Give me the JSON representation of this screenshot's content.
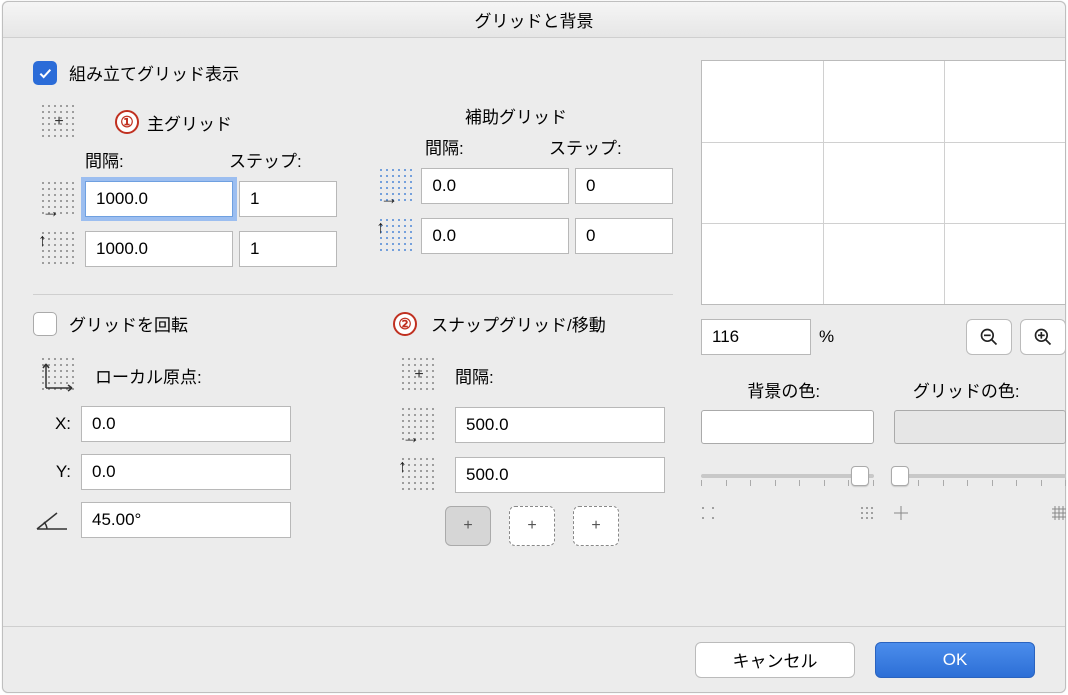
{
  "title": "グリッドと背景",
  "show_construction_grid_label": "組み立てグリッド表示",
  "show_construction_grid_checked": true,
  "main_grid": {
    "badge": "①",
    "title": "主グリッド",
    "spacing_label": "間隔:",
    "step_label": "ステップ:",
    "spacing_x": "1000.0",
    "step_x": "1",
    "spacing_y": "1000.0",
    "step_y": "1"
  },
  "aux_grid": {
    "title": "補助グリッド",
    "spacing_label": "間隔:",
    "step_label": "ステップ:",
    "spacing_x": "0.0",
    "step_x": "0",
    "spacing_y": "0.0",
    "step_y": "0"
  },
  "rotate_grid_label": "グリッドを回転",
  "rotate_grid_checked": false,
  "local_origin_label": "ローカル原点:",
  "x_label": "X:",
  "y_label": "Y:",
  "origin": {
    "x": "0.0",
    "y": "0.0",
    "angle": "45.00°"
  },
  "snap_grid": {
    "badge": "②",
    "title": "スナップグリッド/移動",
    "spacing_label": "間隔:",
    "spacing_x": "500.0",
    "spacing_y": "500.0"
  },
  "zoom": {
    "value": "116",
    "percent": "%"
  },
  "bg_color_label": "背景の色:",
  "grid_color_label": "グリッドの色:",
  "buttons": {
    "cancel": "キャンセル",
    "ok": "OK"
  }
}
